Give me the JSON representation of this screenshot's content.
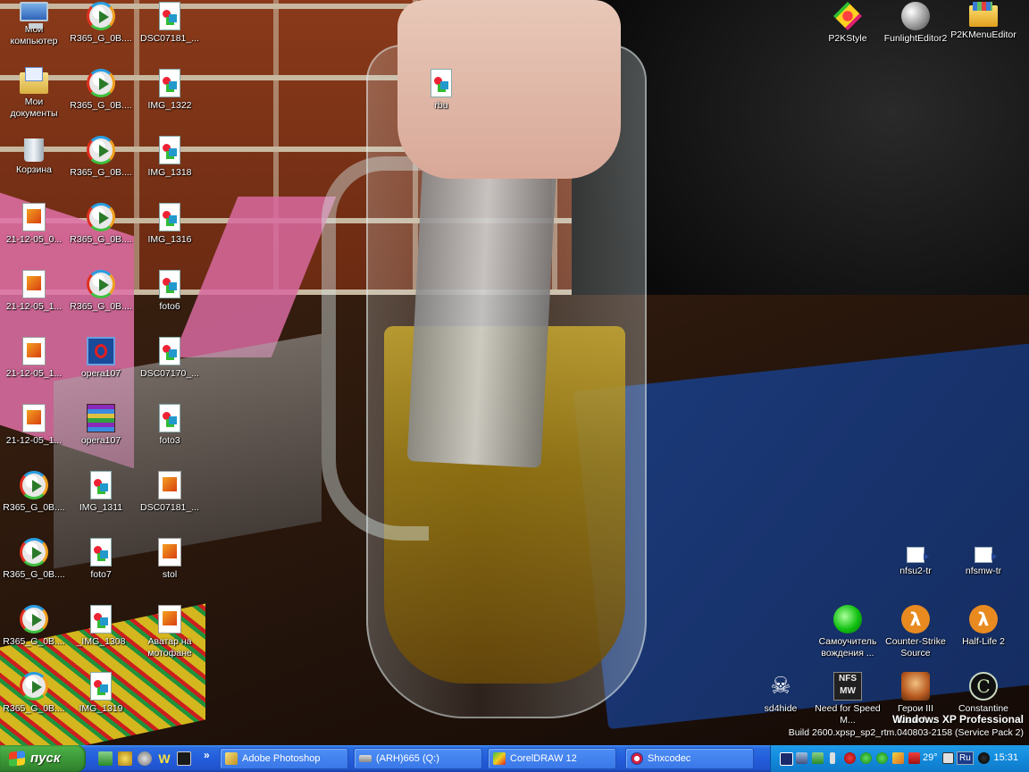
{
  "desktop": {
    "icons": [
      {
        "label": "Мой компьютер",
        "icon": "my-computer-icon"
      },
      {
        "label": "Мои документы",
        "icon": "my-documents-icon"
      },
      {
        "label": "Корзина",
        "icon": "recycle-bin-icon"
      },
      {
        "label": "21-12-05_0...",
        "icon": "image-file-icon"
      },
      {
        "label": "21-12-05_1...",
        "icon": "image-file-icon"
      },
      {
        "label": "21-12-05_1...",
        "icon": "image-file-icon"
      },
      {
        "label": "21-12-05_1...",
        "icon": "image-file-icon"
      },
      {
        "label": "R365_G_0B....",
        "icon": "media-player-icon"
      },
      {
        "label": "R365_G_0B....",
        "icon": "media-player-icon"
      },
      {
        "label": "R365_G_0B....",
        "icon": "media-player-icon"
      },
      {
        "label": "R365_G_0B....",
        "icon": "media-player-icon"
      },
      {
        "label": "R365_G_0B....",
        "icon": "media-player-icon"
      },
      {
        "label": "R365_G_0B....",
        "icon": "media-player-icon"
      },
      {
        "label": "R365_G_0B....",
        "icon": "media-player-icon"
      },
      {
        "label": "R365_G_0B....",
        "icon": "media-player-icon"
      },
      {
        "label": "R365_G_0B....",
        "icon": "media-player-icon"
      },
      {
        "label": "R365_G_0B....",
        "icon": "media-player-icon"
      },
      {
        "label": "R365_G_0B....",
        "icon": "media-player-icon"
      },
      {
        "label": "opera107",
        "icon": "opera-icon"
      },
      {
        "label": "opera107",
        "icon": "winrar-icon"
      },
      {
        "label": "IMG_1311",
        "icon": "image-file-icon"
      },
      {
        "label": "foto7",
        "icon": "image-file-icon"
      },
      {
        "label": "_IMG_1308",
        "icon": "image-file-icon"
      },
      {
        "label": "IMG_1319",
        "icon": "image-file-icon"
      },
      {
        "label": "DSC07181_...",
        "icon": "image-file-icon"
      },
      {
        "label": "IMG_1322",
        "icon": "image-file-icon"
      },
      {
        "label": "IMG_1318",
        "icon": "image-file-icon"
      },
      {
        "label": "IMG_1316",
        "icon": "image-file-icon"
      },
      {
        "label": "foto6",
        "icon": "image-file-icon"
      },
      {
        "label": "DSC07170_...",
        "icon": "image-file-icon"
      },
      {
        "label": "foto3",
        "icon": "image-file-icon"
      },
      {
        "label": "DSC07181_...",
        "icon": "image-file-icon"
      },
      {
        "label": "stol",
        "icon": "image-file-icon"
      },
      {
        "label": "Аватар на мотофане",
        "icon": "image-file-icon"
      },
      {
        "label": "rbu",
        "icon": "image-file-icon"
      },
      {
        "label": "P2KStyle",
        "icon": "p2kstyle-icon"
      },
      {
        "label": "FunlightEditor2",
        "icon": "funlight-editor-icon"
      },
      {
        "label": "P2KMenuEditor",
        "icon": "p2k-menu-editor-icon"
      },
      {
        "label": "nfsu2-tr",
        "icon": "shortcut-file-icon"
      },
      {
        "label": "nfsmw-tr",
        "icon": "shortcut-file-icon"
      },
      {
        "label": "Самоучитель вождения ...",
        "icon": "green-ball-icon"
      },
      {
        "label": "Counter-Strike Source",
        "icon": "half-life-icon"
      },
      {
        "label": "Half-Life 2",
        "icon": "half-life-icon"
      },
      {
        "label": "sd4hide",
        "icon": "skull-icon"
      },
      {
        "label": "Need for Speed M...",
        "icon": "nfs-mw-icon"
      },
      {
        "label": "Герои III Wizards..",
        "icon": "heroes-icon"
      },
      {
        "label": "Constantine",
        "icon": "constantine-icon"
      }
    ]
  },
  "watermark": {
    "title": "Windows XP Professional",
    "build": "Build 2600.xpsp_sp2_rtm.040803-2158 (Service Pack 2)"
  },
  "taskbar": {
    "start_label": "пуск",
    "quicklaunch_more": "»",
    "tasks": [
      {
        "label": "Adobe Photoshop",
        "icon": "photoshop-icon"
      },
      {
        "label": "(ARH)665 (Q:)",
        "icon": "drive-icon"
      },
      {
        "label": "CorelDRAW 12",
        "icon": "coreldraw-icon"
      },
      {
        "label": "Shxcodec",
        "icon": "shxcodec-icon"
      }
    ],
    "tray": {
      "temperature": "29°",
      "language": "Ru",
      "clock": "15:31"
    }
  },
  "colors": {
    "taskbar_blue": "#245ddb",
    "start_green": "#3c9a38",
    "tray_blue": "#138bdc"
  }
}
